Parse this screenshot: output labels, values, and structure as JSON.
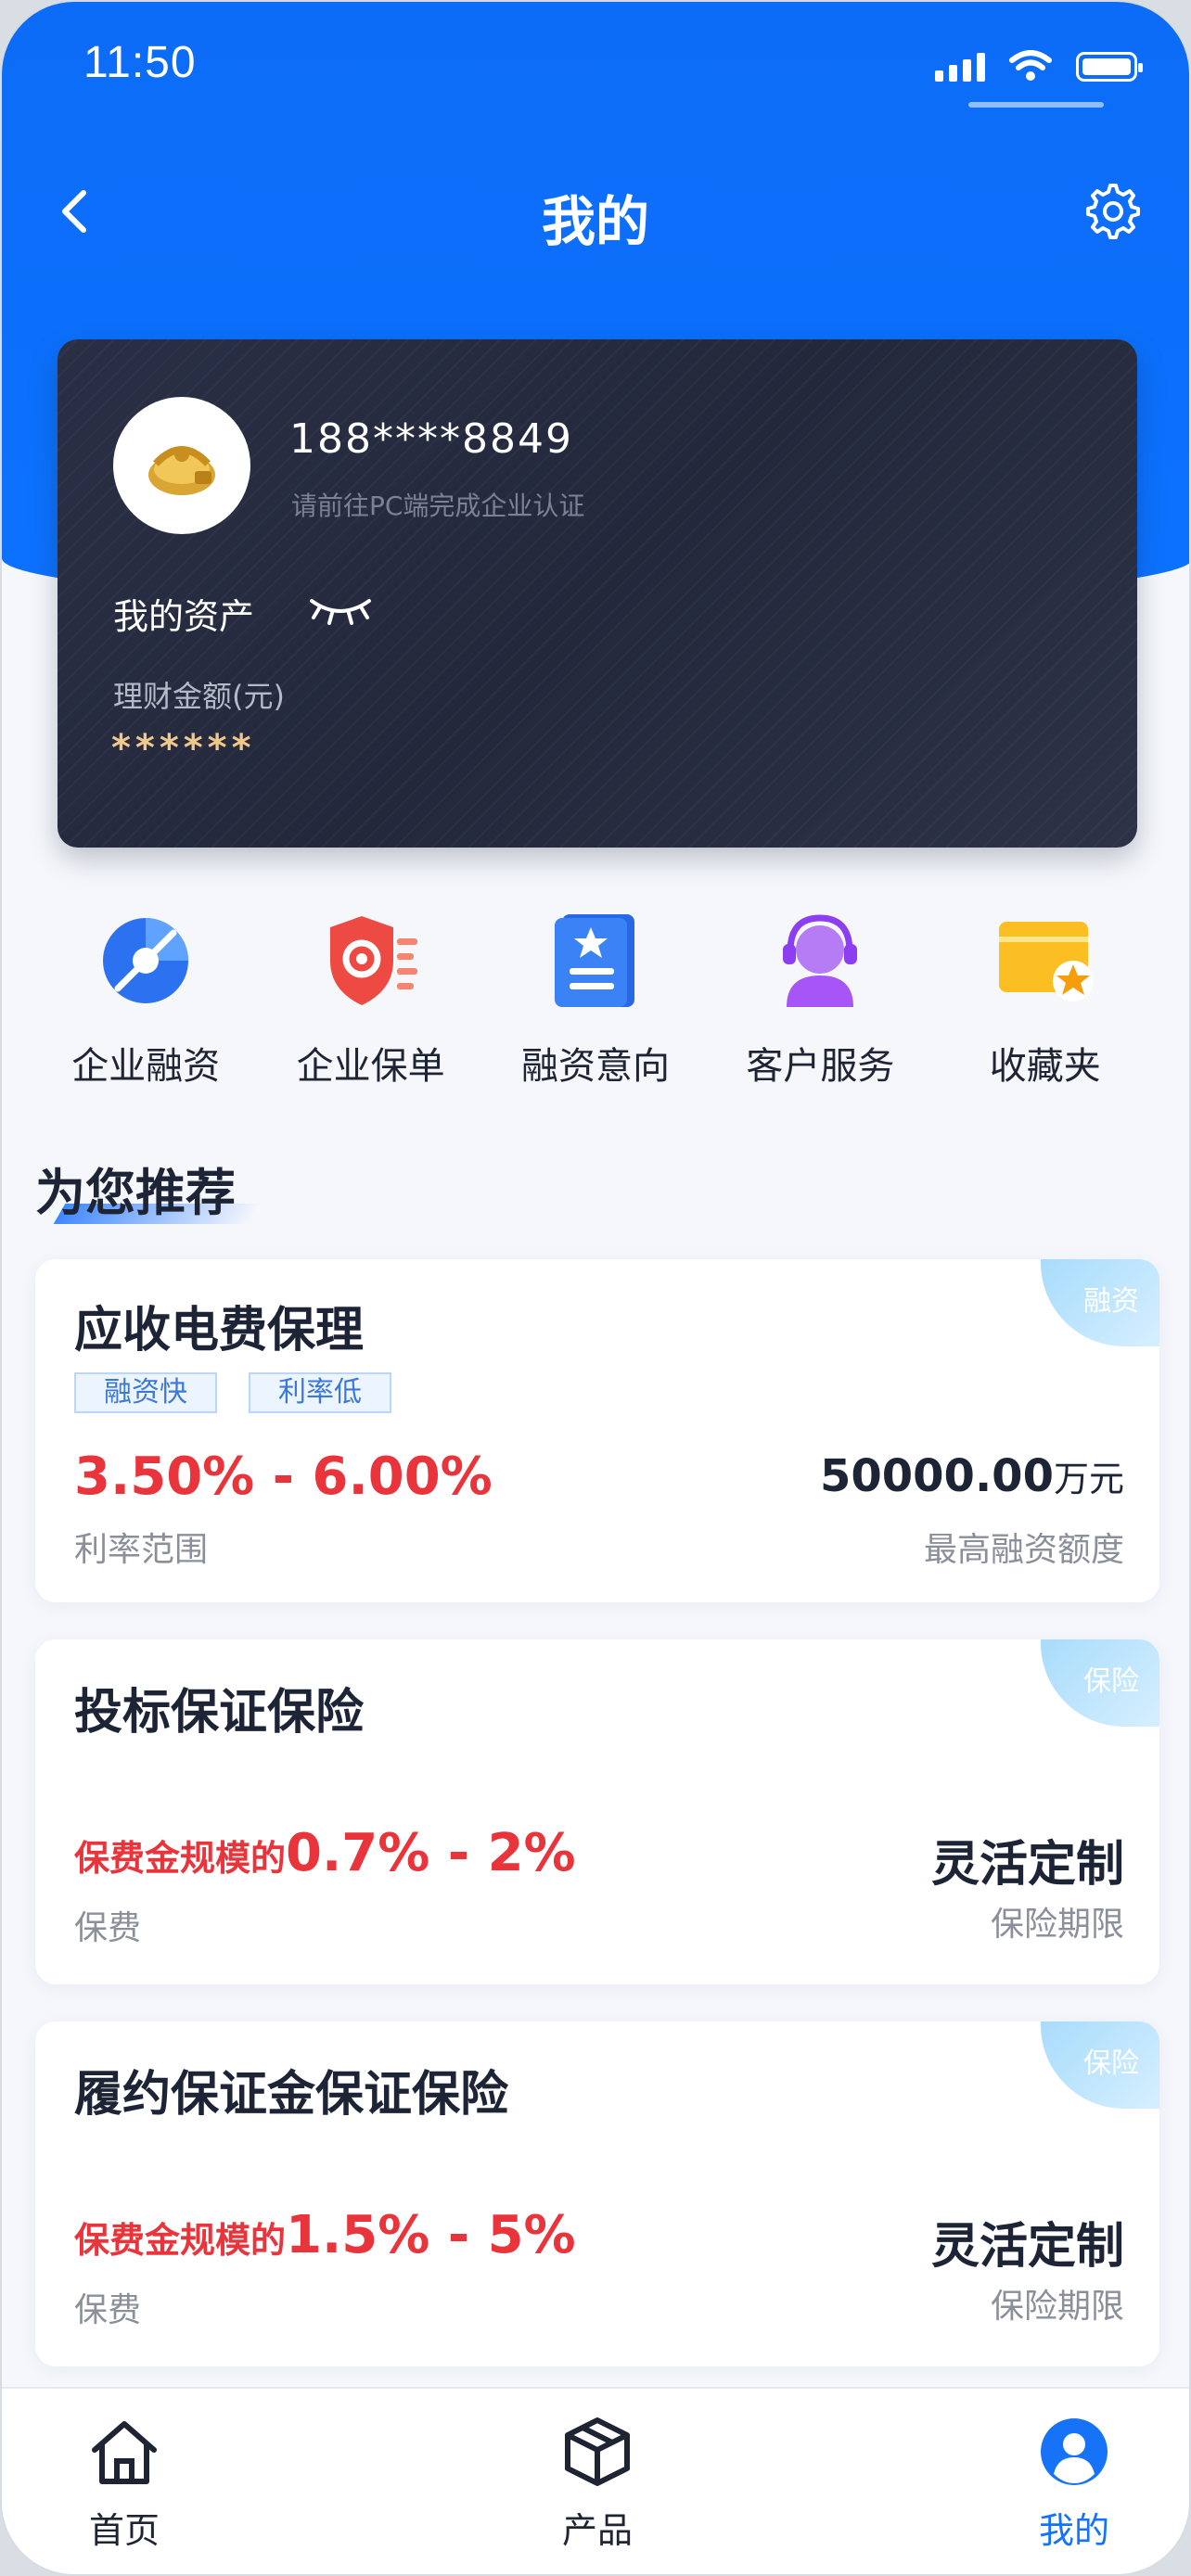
{
  "status_bar": {
    "time": "11:50"
  },
  "nav": {
    "title": "我的"
  },
  "profile": {
    "phone": "188****8849",
    "cert_hint": "请前往PC端完成企业认证",
    "assets_label": "我的资产",
    "amount_label": "理财金额(元)",
    "amount_masked": "******"
  },
  "shortcuts": [
    {
      "label": "企业融资",
      "icon": "financing-icon"
    },
    {
      "label": "企业保单",
      "icon": "policy-shield-icon"
    },
    {
      "label": "融资意向",
      "icon": "intent-book-icon"
    },
    {
      "label": "客户服务",
      "icon": "customer-service-icon"
    },
    {
      "label": "收藏夹",
      "icon": "favorites-icon"
    }
  ],
  "recommend": {
    "title": "为您推荐"
  },
  "products": [
    {
      "tag": "融资",
      "name": "应收电费保理",
      "chips": [
        "融资快",
        "利率低"
      ],
      "rate": "3.50% - 6.00%",
      "rate_label": "利率范围",
      "right_value": "50000.00",
      "right_unit": "万元",
      "right_label": "最高融资额度"
    },
    {
      "tag": "保险",
      "name": "投标保证保险",
      "rate_prefix": "保费金规模的",
      "rate": "0.7% - 2%",
      "rate_label": "保费",
      "right_value": "灵活定制",
      "right_label": "保险期限"
    },
    {
      "tag": "保险",
      "name": "履约保证金保证保险",
      "rate_prefix": "保费金规模的",
      "rate": "1.5% - 5%",
      "rate_label": "保费",
      "right_value": "灵活定制",
      "right_label": "保险期限"
    }
  ],
  "tabbar": [
    {
      "label": "首页",
      "icon": "home-icon"
    },
    {
      "label": "产品",
      "icon": "product-box-icon"
    },
    {
      "label": "我的",
      "icon": "profile-icon",
      "active": true
    }
  ],
  "colors": {
    "brand_blue": "#0c72ff",
    "rate_red": "#e8343a",
    "card_dark": "#262b3e",
    "gold": "#f0c88a"
  }
}
